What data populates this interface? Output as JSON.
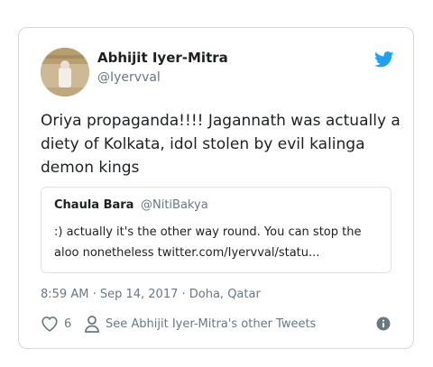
{
  "author": {
    "name": "Abhijit Iyer-Mitra",
    "handle": "@Iyervval"
  },
  "tweet": {
    "text": "Oriya propaganda!!!! Jagannath was actually a diety of Kolkata, idol stolen by evil kalinga demon kings"
  },
  "quoted": {
    "name": "Chaula Bara",
    "handle": "@NitiBakya",
    "text": ":) actually it's the other way round. You can stop the aloo nonetheless twitter.com/Iyervval/statu..."
  },
  "meta": {
    "timestamp": "8:59 AM · Sep 14, 2017 · Doha, Qatar"
  },
  "actions": {
    "like_count": "6",
    "other_tweets": "See Abhijit Iyer-Mitra's other Tweets"
  },
  "colors": {
    "twitter_blue": "#1da1f2",
    "secondary_text": "#697882",
    "border": "#d8d8d8"
  },
  "icons": {
    "brand": "twitter-bird-icon",
    "like": "heart-icon",
    "profile": "person-icon",
    "info": "info-icon"
  }
}
